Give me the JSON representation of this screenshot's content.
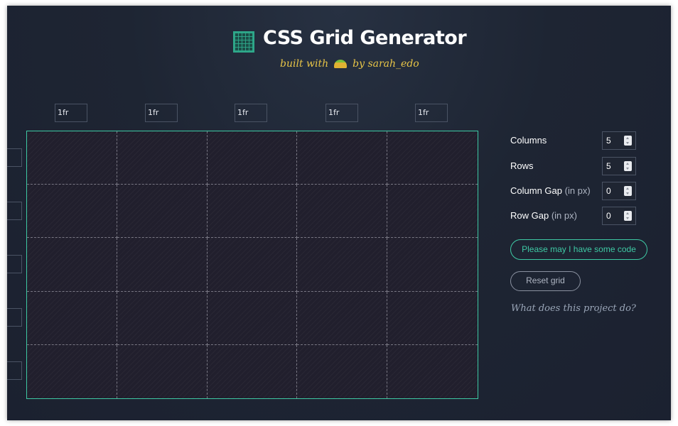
{
  "header": {
    "title": "CSS Grid Generator",
    "tagline_prefix": "built with",
    "tagline_suffix": "by sarah_edo"
  },
  "columns": [
    "1fr",
    "1fr",
    "1fr",
    "1fr",
    "1fr"
  ],
  "controls": {
    "columns_label": "Columns",
    "columns_value": "5",
    "rows_label": "Rows",
    "rows_value": "5",
    "column_gap_label": "Column Gap",
    "column_gap_unit": "(in px)",
    "column_gap_value": "0",
    "row_gap_label": "Row Gap",
    "row_gap_unit": "(in px)",
    "row_gap_value": "0"
  },
  "buttons": {
    "code_label": "Please may I have some code",
    "reset_label": "Reset grid"
  },
  "help_link": "What does this project do?",
  "colors": {
    "background": "#1e2533",
    "accent": "#3ec9a4",
    "tagline": "#e8c547"
  },
  "icons": {
    "logo": "grid-logo-icon",
    "taco": "taco-icon"
  }
}
